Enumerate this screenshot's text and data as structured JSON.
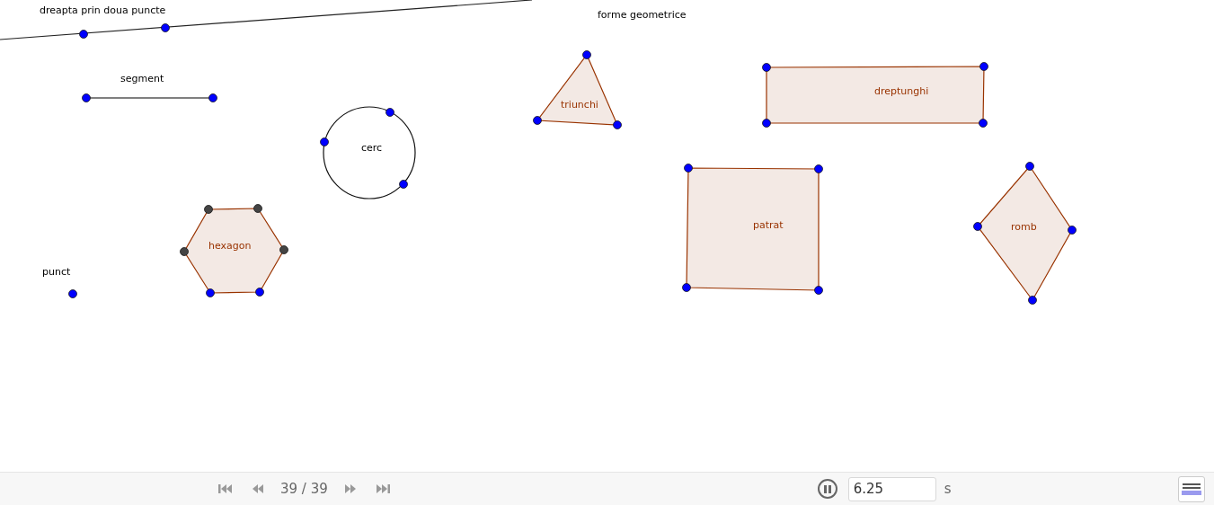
{
  "canvas": {
    "title": "forme geometrice",
    "shapes": [
      {
        "kind": "line",
        "label": "dreapta prin doua puncte"
      },
      {
        "kind": "segment",
        "label": "segment"
      },
      {
        "kind": "point",
        "label": "punct"
      },
      {
        "kind": "circle",
        "label": "cerc"
      },
      {
        "kind": "hexagon",
        "label": "hexagon"
      },
      {
        "kind": "triangle",
        "label": "triunchi"
      },
      {
        "kind": "rectangle",
        "label": "dreptunghi"
      },
      {
        "kind": "square",
        "label": "patrat"
      },
      {
        "kind": "rhombus",
        "label": "romb"
      }
    ]
  },
  "player": {
    "step": "39 / 39",
    "playing": true,
    "speed": "6.25",
    "unit": "s"
  }
}
